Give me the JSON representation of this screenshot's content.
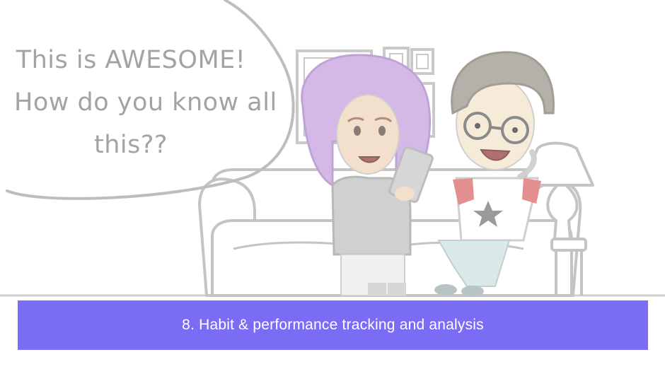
{
  "speech_bubble": {
    "line1": "This is AWESOME!",
    "line2": "How do you know all",
    "line3": "this??"
  },
  "caption": {
    "text": "8. Habit & performance tracking and analysis"
  },
  "colors": {
    "caption_background": "#7b6cf6",
    "caption_text": "#ffffff",
    "sketch_lines": "#c8c8c8",
    "hair_purple": "#d4b8e6",
    "skin": "#f2dfcc",
    "shirt_red": "#e48f8f"
  }
}
